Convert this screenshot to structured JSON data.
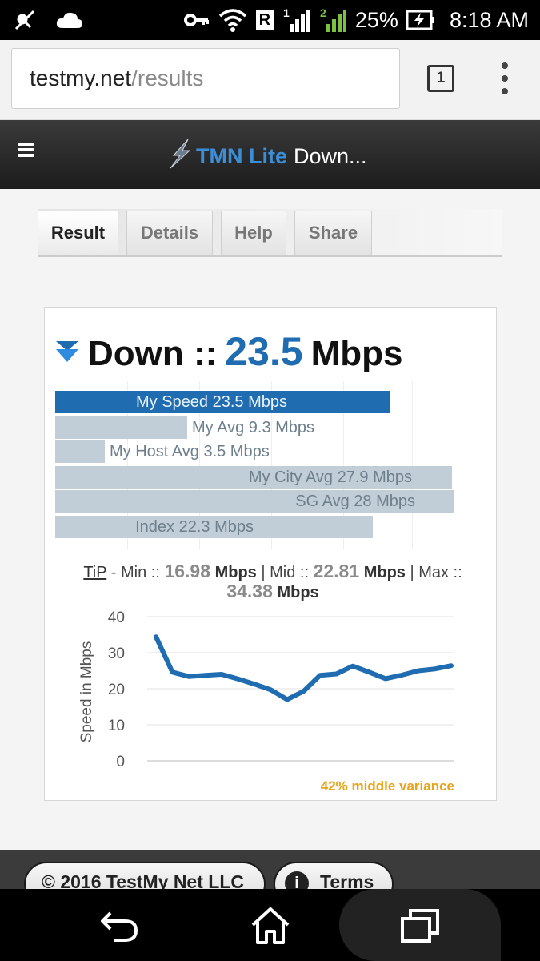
{
  "status_bar": {
    "battery": "25%",
    "time": "8:18 AM",
    "network_roaming": "R",
    "sim1": "1",
    "sim2": "2",
    "icons": [
      "satellite-icon",
      "cloud-icon",
      "key-icon",
      "wifi-icon",
      "signal-icon",
      "battery-charging-icon"
    ]
  },
  "browser": {
    "url_host": "testmy.net",
    "url_path": "/results",
    "tab_count": "1"
  },
  "site_header": {
    "brand": "TMN Lite",
    "title_rest": "Down..."
  },
  "tabs": [
    {
      "label": "Result"
    },
    {
      "label": "Details"
    },
    {
      "label": "Help"
    },
    {
      "label": "Share"
    }
  ],
  "result": {
    "down_label": "Down ::",
    "value": "23.5",
    "unit": "Mbps"
  },
  "bars": [
    {
      "label": "My Speed 23.5 Mbps",
      "value": 23.5
    },
    {
      "label": "My Avg 9.3 Mbps",
      "value": 9.3
    },
    {
      "label": "My Host Avg 3.5 Mbps",
      "value": 3.5
    },
    {
      "label": "My City Avg 27.9 Mbps",
      "value": 27.9
    },
    {
      "label": "SG Avg 28 Mbps",
      "value": 28
    },
    {
      "label": "Index 22.3 Mbps",
      "value": 22.3
    }
  ],
  "tip": {
    "link": "TiP",
    "min_label": " - Min :: ",
    "min_value": "16.98",
    "mid_label": " | Mid :: ",
    "mid_value": "22.81",
    "max_label": " | Max :: ",
    "max_value": "34.38",
    "unit": "Mbps"
  },
  "chart_data": {
    "type": "line",
    "ylabel": "Speed in Mbps",
    "ylim": [
      0,
      40
    ],
    "yticks": [
      "40",
      "30",
      "20",
      "10",
      "0"
    ],
    "grid": true,
    "series": [
      {
        "values": [
          34.4,
          24.6,
          23.4,
          23.7,
          24.0,
          22.7,
          21.3,
          19.7,
          17.0,
          19.3,
          23.7,
          24.1,
          26.3,
          24.6,
          22.8,
          23.8,
          25.0,
          25.5,
          26.4
        ]
      }
    ],
    "annotation": "42% middle variance"
  },
  "footer": {
    "copyright": "© 2016 TestMy Net LLC",
    "terms": "Terms",
    "info_glyph": "i"
  },
  "nav": {
    "icons": [
      "back-icon",
      "home-icon",
      "recents-icon"
    ]
  }
}
